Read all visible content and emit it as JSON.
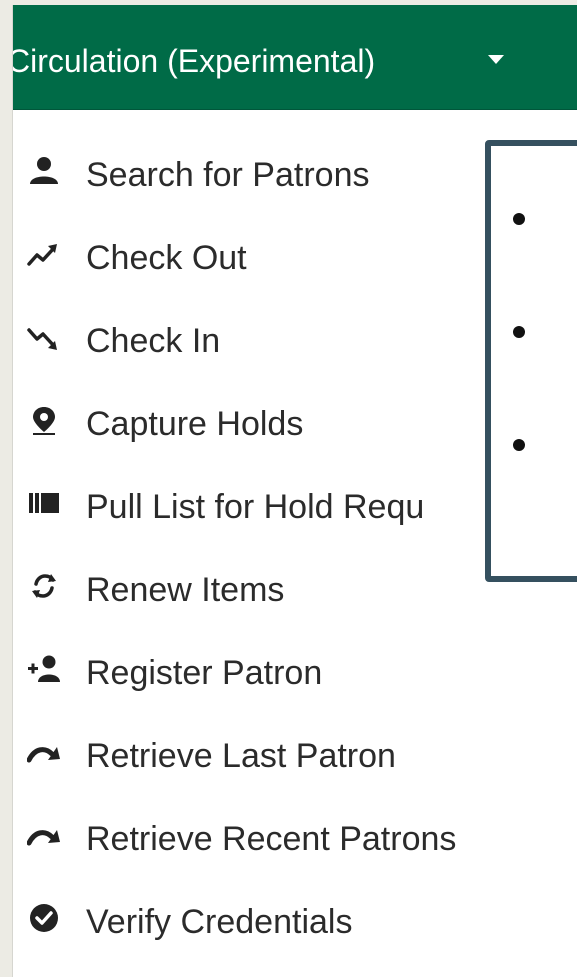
{
  "menu": {
    "title": "Circulation (Experimental)",
    "items": [
      {
        "label": "Search for Patrons",
        "icon": "user-icon"
      },
      {
        "label": "Check Out",
        "icon": "trend-up-icon"
      },
      {
        "label": "Check In",
        "icon": "trend-down-icon"
      },
      {
        "label": "Capture Holds",
        "icon": "map-pin-icon"
      },
      {
        "label": "Pull List for Hold Requ",
        "icon": "barcode-icon"
      },
      {
        "label": "Renew Items",
        "icon": "refresh-icon"
      },
      {
        "label": "Register Patron",
        "icon": "user-plus-icon"
      },
      {
        "label": "Retrieve Last Patron",
        "icon": "curved-arrow-icon"
      },
      {
        "label": "Retrieve Recent Patrons",
        "icon": "curved-arrow-icon"
      },
      {
        "label": "Verify Credentials",
        "icon": "check-circle-icon"
      }
    ]
  },
  "tooltip": {
    "bullets": [
      "",
      "",
      ""
    ]
  },
  "colors": {
    "header": "#006b47",
    "border": "#35505f",
    "text": "#2b2b2b",
    "background": "#ecebe4"
  }
}
